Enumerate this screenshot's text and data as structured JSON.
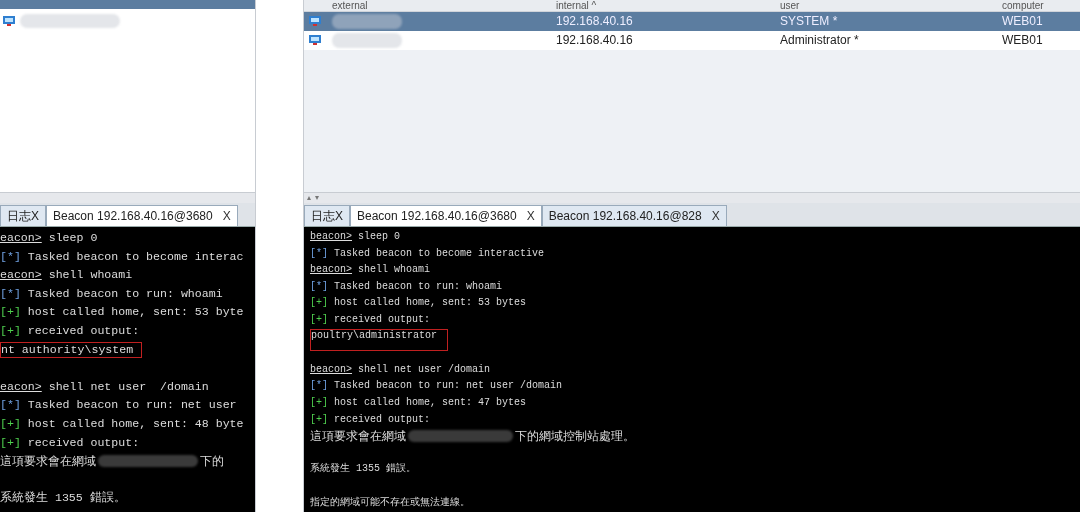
{
  "left_window": {
    "sessions": [
      {
        "selected": true
      },
      {
        "selected": false
      }
    ],
    "tabs": [
      {
        "label": "日志X",
        "selected": false
      },
      {
        "label": "Beacon 192.168.40.16@3680",
        "close": "X",
        "selected": true
      }
    ],
    "console": [
      {
        "kind": "prompt",
        "prompt": "eacon>",
        "text": " sleep 0"
      },
      {
        "kind": "info",
        "mark": "[*]",
        "text": " Tasked beacon to become interac"
      },
      {
        "kind": "prompt",
        "prompt": "eacon>",
        "text": " shell whoami"
      },
      {
        "kind": "info",
        "mark": "[*]",
        "text": " Tasked beacon to run: whoami"
      },
      {
        "kind": "ok",
        "mark": "[+]",
        "text": " host called home, sent: 53 byte"
      },
      {
        "kind": "ok",
        "mark": "[+]",
        "text": " received output:"
      },
      {
        "kind": "output",
        "text": "nt authority\\system",
        "boxed": true
      },
      {
        "kind": "blank"
      },
      {
        "kind": "prompt",
        "prompt": "eacon>",
        "text": " shell net user  /domain"
      },
      {
        "kind": "info",
        "mark": "[*]",
        "text": " Tasked beacon to run: net user"
      },
      {
        "kind": "ok",
        "mark": "[+]",
        "text": " host called home, sent: 48 byte"
      },
      {
        "kind": "ok",
        "mark": "[+]",
        "text": " received output:"
      },
      {
        "kind": "redacted",
        "before": "這項要求會在網域",
        "after": "下的"
      },
      {
        "kind": "blank"
      },
      {
        "kind": "output",
        "text": "系統發生 1355 錯誤。",
        "boxed": false
      }
    ]
  },
  "right_window": {
    "table": {
      "columns": [
        "external",
        "internal ^",
        "user",
        "computer"
      ],
      "rows": [
        {
          "internal": "192.168.40.16",
          "user": "SYSTEM *",
          "computer": "WEB01",
          "selected": true
        },
        {
          "internal": "192.168.40.16",
          "user": "Administrator *",
          "computer": "WEB01",
          "selected": false
        }
      ]
    },
    "tabs": [
      {
        "label": "日志X",
        "selected": false
      },
      {
        "label": "Beacon 192.168.40.16@3680",
        "close": "X",
        "selected": true
      },
      {
        "label": "Beacon 192.168.40.16@828",
        "close": "X",
        "selected": false
      }
    ],
    "console": [
      {
        "kind": "prompt",
        "prompt": "beacon>",
        "text": " sleep 0"
      },
      {
        "kind": "info",
        "mark": "[*]",
        "text": " Tasked beacon to become interactive"
      },
      {
        "kind": "prompt",
        "prompt": "beacon>",
        "text": " shell whoami"
      },
      {
        "kind": "info",
        "mark": "[*]",
        "text": " Tasked beacon to run: whoami"
      },
      {
        "kind": "ok",
        "mark": "[+]",
        "text": " host called home, sent: 53 bytes"
      },
      {
        "kind": "ok",
        "mark": "[+]",
        "text": " received output:"
      },
      {
        "kind": "output",
        "text": "poultry\\administrator",
        "boxed": true
      },
      {
        "kind": "blank"
      },
      {
        "kind": "prompt",
        "prompt": "beacon>",
        "text": " shell net user /domain"
      },
      {
        "kind": "info",
        "mark": "[*]",
        "text": " Tasked beacon to run: net user /domain"
      },
      {
        "kind": "ok",
        "mark": "[+]",
        "text": " host called home, sent: 47 bytes"
      },
      {
        "kind": "ok",
        "mark": "[+]",
        "text": " received output:"
      },
      {
        "kind": "redacted",
        "before": "這項要求會在網域",
        "after": "下的網域控制站處理。"
      },
      {
        "kind": "blank"
      },
      {
        "kind": "output",
        "text": "系統發生 1355 錯誤。",
        "boxed": false
      },
      {
        "kind": "blank"
      },
      {
        "kind": "output",
        "text": "指定的網域可能不存在或無法連線。",
        "boxed": false
      }
    ]
  }
}
